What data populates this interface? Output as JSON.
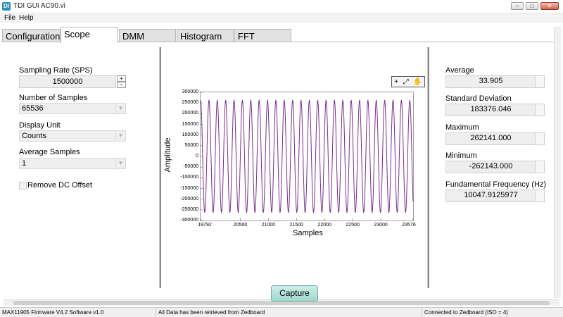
{
  "window": {
    "title": "TDI GUI AC90.vi",
    "icon_text": "DI",
    "controls": [
      "–",
      "□",
      "✕"
    ]
  },
  "menu": [
    "File",
    "Help"
  ],
  "tabs": [
    "Configuration",
    "Scope",
    "DMM",
    "Histogram",
    "FFT"
  ],
  "active_tab": "Scope",
  "left_panel": {
    "sampling_rate_label": "Sampling Rate (SPS)",
    "sampling_rate_value": "1500000",
    "num_samples_label": "Number of Samples",
    "num_samples_value": "65536",
    "display_unit_label": "Display Unit",
    "display_unit_value": "Counts",
    "avg_samples_label": "Average Samples",
    "avg_samples_value": "1",
    "remove_dc_label": "Remove DC Offset",
    "remove_dc_checked": false
  },
  "graph": {
    "tools": [
      "+",
      "⤢",
      "✋"
    ],
    "trace_color": "#7b2d8e"
  },
  "chart_data": {
    "type": "line",
    "xlabel": "Samples",
    "ylabel": "Amplitude",
    "xlim": [
      19792,
      23576
    ],
    "ylim": [
      -300000,
      300000
    ],
    "x_ticks": [
      "19792",
      "20500",
      "21000",
      "21500",
      "22000",
      "22500",
      "23000",
      "23576"
    ],
    "x_tick_values": [
      19792,
      20500,
      21000,
      21500,
      22000,
      22500,
      23000,
      23576
    ],
    "y_ticks": [
      "300000",
      "250000",
      "200000",
      "150000",
      "100000",
      "50000",
      "0",
      "-50000",
      "-100000",
      "-150000",
      "-200000",
      "-250000",
      "-300000"
    ],
    "y_tick_values": [
      300000,
      250000,
      200000,
      150000,
      100000,
      50000,
      0,
      -50000,
      -100000,
      -150000,
      -200000,
      -250000,
      -300000
    ],
    "series": [
      {
        "amplitude": 262141,
        "cycles": 25.4,
        "phase_deg": 90,
        "offset": 34
      }
    ]
  },
  "stats": [
    {
      "label": "Average",
      "value": "33.905"
    },
    {
      "label": "Standard Deviation",
      "value": "183376.046"
    },
    {
      "label": "Maximum",
      "value": "262141.000"
    },
    {
      "label": "Minimum",
      "value": "-262143.000"
    },
    {
      "label": "Fundamental Frequency (Hz)",
      "value": "10047.9125977"
    }
  ],
  "capture_label": "Capture",
  "status": {
    "left": "MAX11905 Firmware V4.2 Software v1.0",
    "middle": "All Data has been retrieved from Zedboard",
    "right": "Connected to Zedboard (ISO = 4)"
  }
}
